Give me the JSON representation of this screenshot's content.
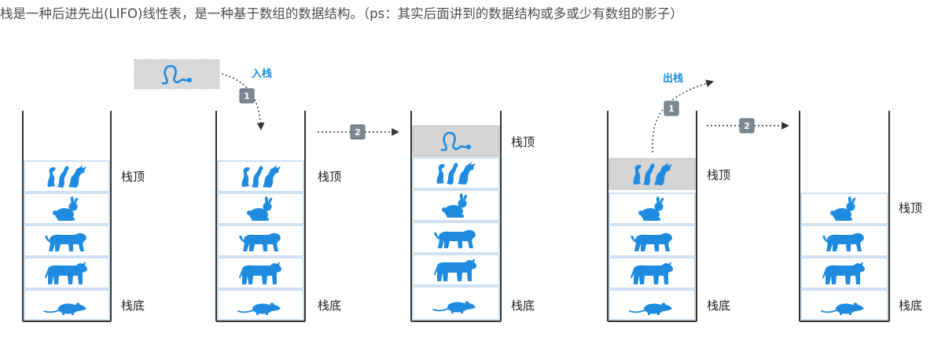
{
  "intro_text": "栈是一种后进先出(LIFO)线性表，是一种基于数组的数据结构。（ps：其实后面讲到的数据结构或多或少有数组的影子）",
  "labels": {
    "top": "栈顶",
    "bottom": "栈底",
    "push": "入栈",
    "pop": "出栈",
    "step1": "1",
    "step2": "2"
  },
  "colors": {
    "animal": "#1e8be0",
    "operation_text": "#1a8fe3",
    "highlight": "#d5d5d5"
  },
  "stacks": [
    {
      "items": [
        "dragon-icon",
        "rabbit-icon",
        "tiger-icon",
        "ox-icon",
        "rat-icon"
      ]
    },
    {
      "items": [
        "dragon-icon",
        "rabbit-icon",
        "tiger-icon",
        "ox-icon",
        "rat-icon"
      ],
      "incoming": "snake-icon"
    },
    {
      "items": [
        "snake-icon",
        "dragon-icon",
        "rabbit-icon",
        "tiger-icon",
        "ox-icon",
        "rat-icon"
      ]
    },
    {
      "items": [
        "dragon-icon",
        "rabbit-icon",
        "tiger-icon",
        "ox-icon",
        "rat-icon"
      ],
      "outgoing": "dragon-icon"
    },
    {
      "items": [
        "rabbit-icon",
        "tiger-icon",
        "ox-icon",
        "rat-icon"
      ]
    }
  ]
}
